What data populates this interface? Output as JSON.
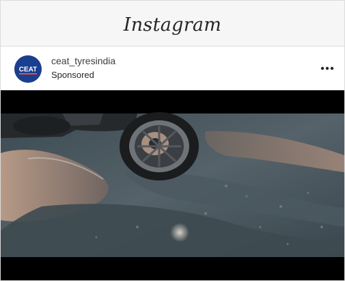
{
  "app": {
    "title": "Instagram"
  },
  "post": {
    "username": "ceat_tyresindia",
    "sponsored_label": "Sponsored",
    "avatar_label": "CEAT",
    "more_icon": "more-horizontal-icon",
    "media_description": "motorcycle-wheel-through-puddle-video"
  },
  "colors": {
    "topbar_bg": "#f6f6f6",
    "avatar_bg": "#1b3f8f",
    "text": "#262626"
  }
}
